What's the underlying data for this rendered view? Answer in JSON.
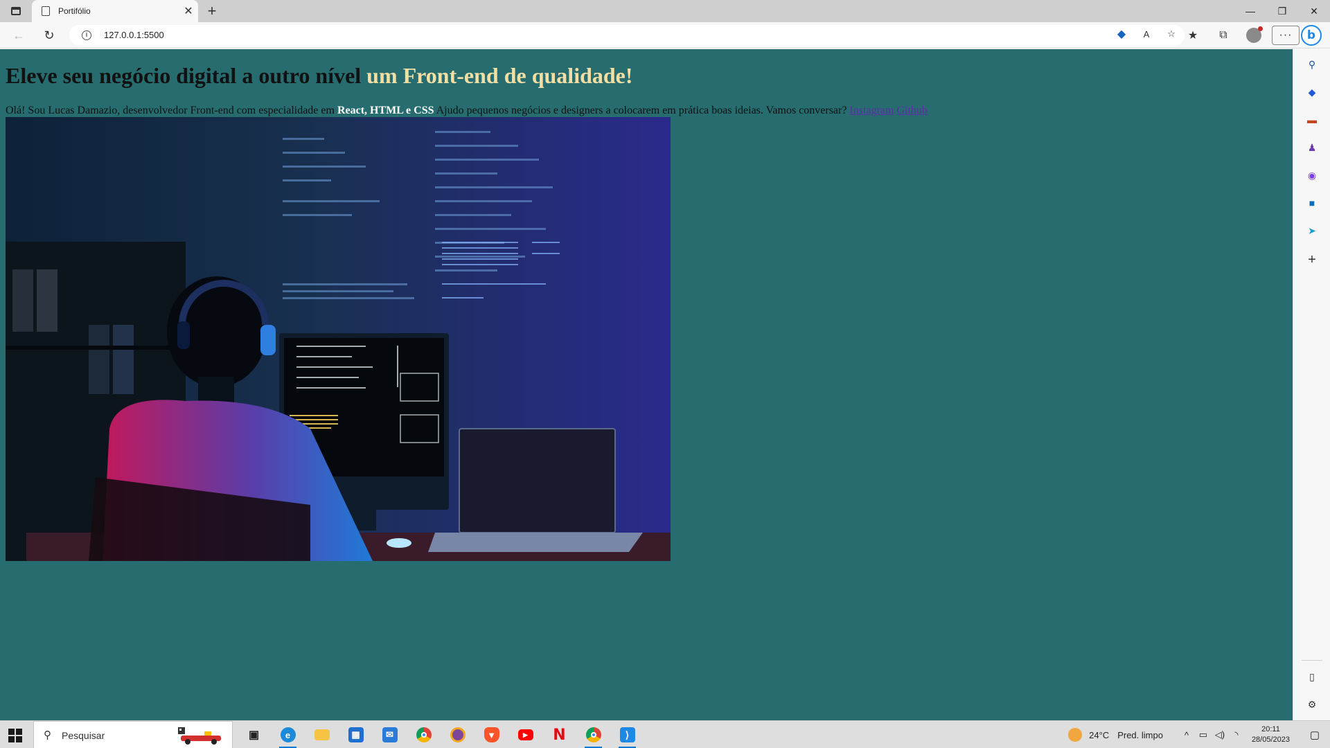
{
  "browser": {
    "tab_title": "Portifólio",
    "url": "127.0.0.1:5500",
    "new_tab_symbol": "+",
    "close_tab_symbol": "✕"
  },
  "page": {
    "headline_main": "Eleve seu negócio digital a outro nível",
    "headline_accent": "um Front-end de qualidade!",
    "intro_start": "Olá! Sou Lucas Damazio, desenvolvedor Front-end com especialidade em",
    "intro_highlight": "React, HTML e CSS",
    "intro_end": "Ajudo pequenos negócios e designers a colocarem em prática boas ideias. Vamos conversar?",
    "link_instagram": "Instagram",
    "link_github": "Github",
    "colors": {
      "background": "#276c6f",
      "accent": "#f3dfa4",
      "link": "#5a2fa3"
    }
  },
  "sidebar": {
    "icons": [
      "search-icon",
      "tag-icon",
      "toolbox-icon",
      "games-icon",
      "office-icon",
      "outlook-icon",
      "send-icon",
      "add-icon",
      "split-panel-icon",
      "settings-icon"
    ]
  },
  "taskbar": {
    "search_placeholder": "Pesquisar",
    "weather_temp": "24°C",
    "weather_desc": "Pred. limpo",
    "time": "20:11",
    "date": "28/05/2023",
    "apps": [
      "task-view-icon",
      "edge-icon",
      "file-explorer-icon",
      "store-icon",
      "mail-icon",
      "chrome-icon",
      "tor-icon",
      "brave-icon",
      "youtube-icon",
      "netflix-icon",
      "chrome-profile-icon",
      "vscode-icon"
    ]
  }
}
